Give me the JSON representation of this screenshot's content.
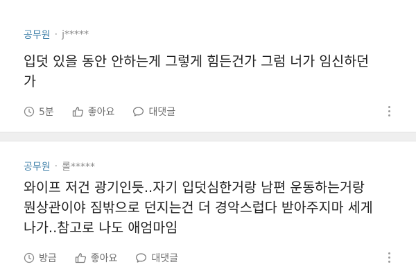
{
  "comments": [
    {
      "author": "공무원",
      "user_id": "j*****",
      "text_lines": [
        "입덧 있을 동안 안하는게 그렇게 힘든건가 그럼 너가 임신하던",
        "가"
      ],
      "time": "5분",
      "like_label": "좋아요",
      "reply_label": "대댓글",
      "icons": [
        "clock-icon",
        "thumbs-up-icon",
        "speech-bubble-icon",
        "more-vertical-icon"
      ]
    },
    {
      "author": "공무원",
      "user_id": "롤*****",
      "text_lines": [
        "와이프 저건 광기인듯..자기 입덧심한거랑 남편 운동하는거랑",
        "뭔상관이야 짐밖으로 던지는건 더 경악스럽다 받아주지마 세게",
        "나가..참고로 나도 애엄마임"
      ],
      "time": "방금",
      "like_label": "좋아요",
      "reply_label": "대댓글",
      "icons": [
        "clock-icon",
        "thumbs-up-icon",
        "speech-bubble-icon",
        "more-vertical-icon"
      ]
    }
  ],
  "colors": {
    "author": "#3e7fa8",
    "meta": "#8a8a8a",
    "separator": "#efefef"
  }
}
